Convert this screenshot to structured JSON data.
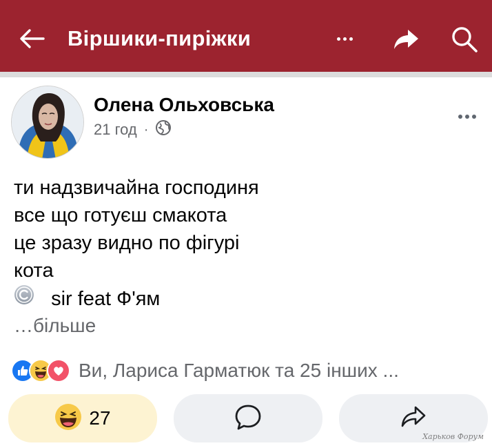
{
  "header": {
    "title": "Віршики-пиріжки",
    "icons": [
      "back-arrow-icon",
      "more-horizontal-icon",
      "share-arrow-icon",
      "search-icon"
    ],
    "background_color": "#9c232f"
  },
  "post": {
    "author": "Олена Ольховська",
    "time": "21 год",
    "separator": "·",
    "privacy_icon": "globe-icon",
    "body_lines": [
      "ти надзвичайна господиня",
      "все що готуєш смакота",
      "це зразу видно по фігурі",
      "кота"
    ],
    "credit": "sir feat Ф'ям",
    "see_more": "…більше"
  },
  "reactions": {
    "icons": [
      "like-reaction-icon",
      "haha-reaction-icon",
      "love-reaction-icon"
    ],
    "summary": "Ви, Лариса Гарматюк та 25 інших ..."
  },
  "actions": {
    "react_count": "27",
    "react_icon": "haha-emoji-icon",
    "comment_icon": "comment-icon",
    "share_icon": "share-icon"
  },
  "watermark": "Харьков Форум"
}
